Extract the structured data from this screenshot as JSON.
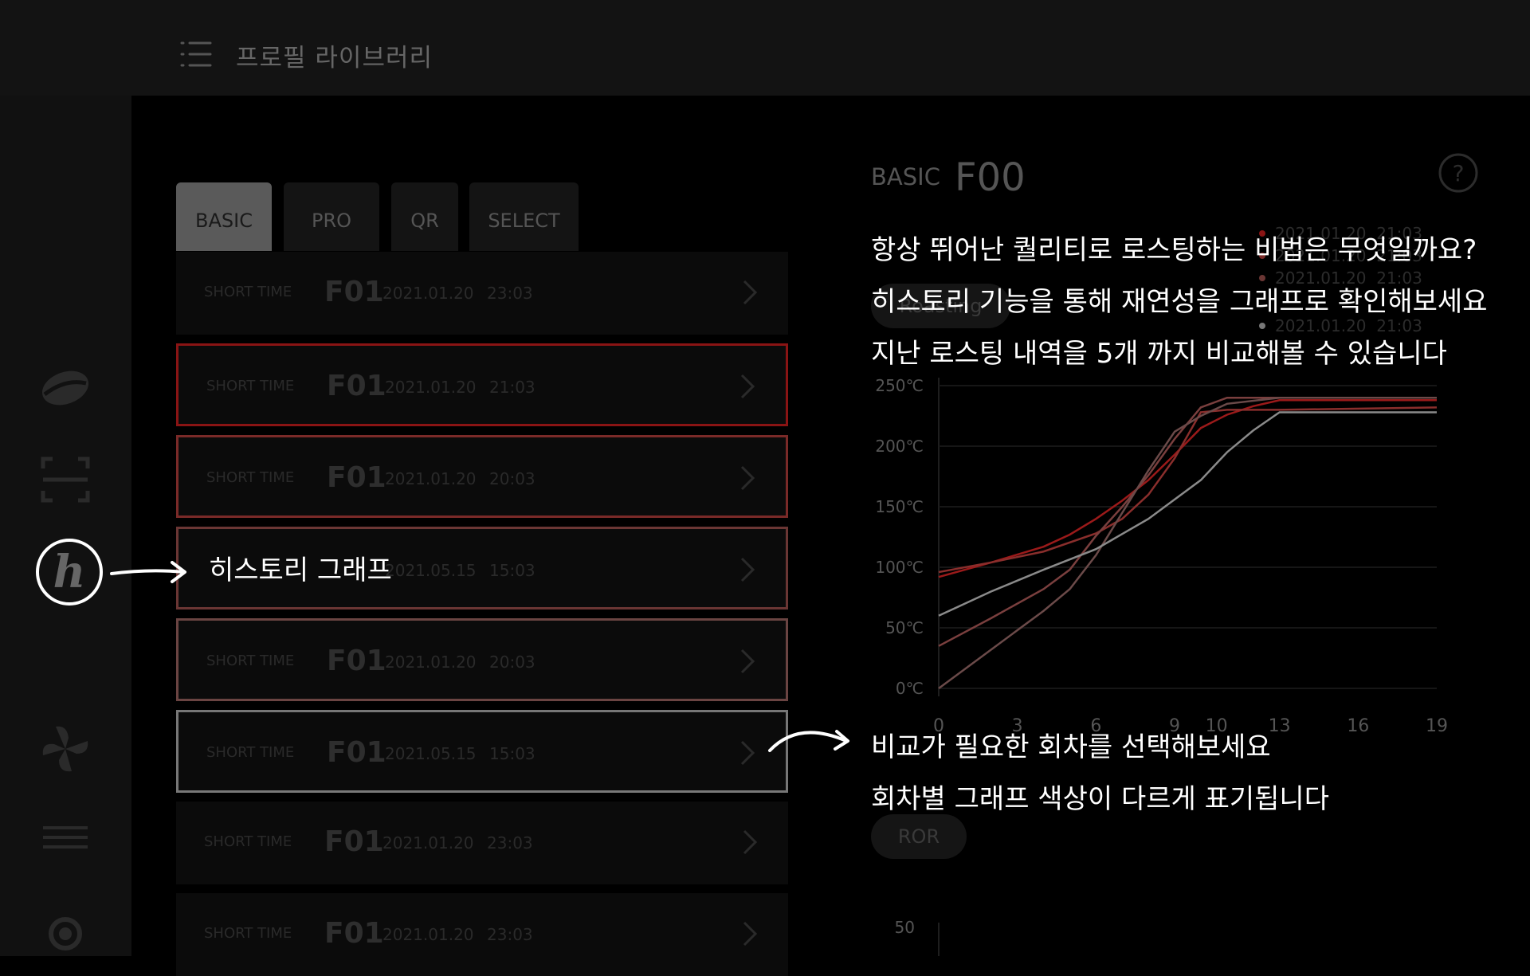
{
  "header": {
    "title": "프로필 라이브러리",
    "menu_icon": "hamburger-menu-icon"
  },
  "sidebar": {
    "items": [
      {
        "icon": "coffee-bean-icon"
      },
      {
        "icon": "qr-scan-icon"
      },
      {
        "icon": "history-h-icon"
      },
      {
        "icon": "fan-icon"
      },
      {
        "icon": "list-icon"
      },
      {
        "icon": "gear-icon"
      }
    ]
  },
  "tabs": [
    {
      "label": "BASIC"
    },
    {
      "label": "PRO"
    },
    {
      "label": "QR"
    },
    {
      "label": "SELECT"
    }
  ],
  "profiles": [
    {
      "label": "SHORT TIME",
      "code": "F01",
      "date": "2021.01.20",
      "time": "23:03",
      "highlight": "",
      "border": ""
    },
    {
      "label": "SHORT TIME",
      "code": "F01",
      "date": "2021.01.20",
      "time": "21:03",
      "highlight": "red",
      "border": "#8a1414"
    },
    {
      "label": "SHORT TIME",
      "code": "F01",
      "date": "2021.01.20",
      "time": "20:03",
      "highlight": "red",
      "border": "#7a2a28"
    },
    {
      "label": "",
      "code": "",
      "date": "2021.05.15",
      "time": "15:03",
      "highlight": "red",
      "border": "#6a3634"
    },
    {
      "label": "SHORT TIME",
      "code": "F01",
      "date": "2021.01.20",
      "time": "20:03",
      "highlight": "red",
      "border": "#6a4442"
    },
    {
      "label": "SHORT TIME",
      "code": "F01",
      "date": "2021.05.15",
      "time": "15:03",
      "highlight": "grey",
      "border": "#777777"
    },
    {
      "label": "SHORT TIME",
      "code": "F01",
      "date": "2021.01.20",
      "time": "23:03",
      "highlight": "",
      "border": ""
    },
    {
      "label": "SHORT TIME",
      "code": "F01",
      "date": "2021.01.20",
      "time": "23:03",
      "highlight": "",
      "border": ""
    }
  ],
  "detail": {
    "type": "BASIC",
    "code": "F00",
    "help_icon": "question-circle-icon",
    "roasting_pill": "Roasting",
    "ror_pill": "ROR",
    "legend": [
      {
        "date": "2021.01.20",
        "time": "21:03",
        "color": "#8a1414"
      },
      {
        "date": "2021.01.20",
        "time": "21:03",
        "color": "#7a2a28"
      },
      {
        "date": "2021.01.20",
        "time": "21:03",
        "color": "#6a3634"
      },
      {
        "date": "2021.01.20",
        "time": "21:03",
        "color": "#777777"
      }
    ],
    "ror_y_top": "50"
  },
  "annotations": {
    "line1": "항상 뛰어난 퀄리티로 로스팅하는 비법은 무엇일까요?",
    "line2": "히스토리 기능을 통해 재연성을 그래프로 확인해보세요",
    "line3": "지난 로스팅 내역을 5개 까지 비교해볼 수 있습니다",
    "history_label": "히스토리 그래프",
    "compare1": "비교가 필요한 회차를 선택해보세요",
    "compare2": "회차별 그래프 색상이 다르게 표기됩니다"
  },
  "chart_data": {
    "type": "line",
    "title": "",
    "xlabel": "",
    "ylabel": "",
    "y_ticks": [
      "250℃",
      "200℃",
      "150℃",
      "100℃",
      "50℃",
      "0℃"
    ],
    "x_ticks": [
      "0",
      "3",
      "6",
      "9",
      "10",
      "13",
      "16",
      "19"
    ],
    "ylim": [
      0,
      250
    ],
    "xlim": [
      0,
      19
    ],
    "grid": true,
    "series": [
      {
        "color": "#9b1a1a",
        "points": [
          [
            0,
            92
          ],
          [
            2,
            104
          ],
          [
            4,
            117
          ],
          [
            5,
            127
          ],
          [
            6,
            140
          ],
          [
            7,
            155
          ],
          [
            8,
            172
          ],
          [
            9,
            193
          ],
          [
            10,
            215
          ],
          [
            11,
            226
          ],
          [
            12,
            233
          ],
          [
            13,
            238
          ],
          [
            19,
            238
          ]
        ]
      },
      {
        "color": "#8a2e2c",
        "points": [
          [
            0,
            96
          ],
          [
            2,
            104
          ],
          [
            4,
            113
          ],
          [
            6,
            128
          ],
          [
            7,
            140
          ],
          [
            8,
            160
          ],
          [
            9,
            190
          ],
          [
            10,
            228
          ],
          [
            11,
            230
          ],
          [
            13,
            230
          ],
          [
            19,
            232
          ]
        ]
      },
      {
        "color": "#7a3f3e",
        "points": [
          [
            0,
            35
          ],
          [
            2,
            58
          ],
          [
            4,
            82
          ],
          [
            5,
            98
          ],
          [
            6,
            126
          ],
          [
            7,
            150
          ],
          [
            8,
            176
          ],
          [
            9,
            206
          ],
          [
            10,
            232
          ],
          [
            11,
            240
          ],
          [
            13,
            240
          ],
          [
            19,
            240
          ]
        ]
      },
      {
        "color": "#6b4a49",
        "points": [
          [
            0,
            0
          ],
          [
            2,
            32
          ],
          [
            4,
            64
          ],
          [
            5,
            82
          ],
          [
            6,
            110
          ],
          [
            7,
            145
          ],
          [
            8,
            180
          ],
          [
            9,
            212
          ],
          [
            10,
            225
          ],
          [
            11,
            235
          ],
          [
            13,
            240
          ],
          [
            19,
            240
          ]
        ]
      },
      {
        "color": "#8a8a8a",
        "points": [
          [
            0,
            60
          ],
          [
            2,
            80
          ],
          [
            4,
            98
          ],
          [
            6,
            115
          ],
          [
            8,
            140
          ],
          [
            10,
            172
          ],
          [
            11,
            195
          ],
          [
            12,
            213
          ],
          [
            13,
            228
          ],
          [
            19,
            228
          ]
        ]
      }
    ]
  }
}
